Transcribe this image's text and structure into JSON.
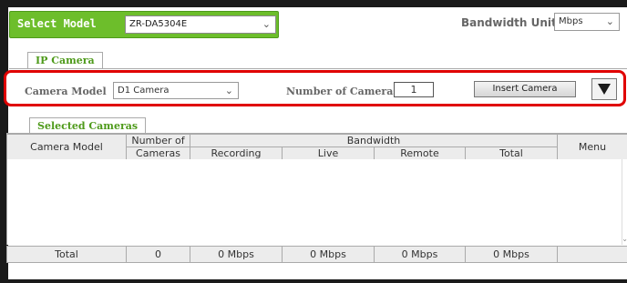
{
  "header": {
    "select_model_label": "Select Model",
    "model_value": "ZR-DA5304E",
    "bandwidth_unit_label": "Bandwidth Unit :",
    "bandwidth_unit_value": "Mbps"
  },
  "ip_camera": {
    "tab_label": "IP Camera",
    "camera_model_label": "Camera Model",
    "camera_model_value": "D1 Camera",
    "number_label": "Number of Cameras",
    "number_value": "1",
    "insert_label": "Insert Camera"
  },
  "selected": {
    "tab_label": "Selected Cameras",
    "columns": {
      "camera_model": "Camera Model",
      "number_of": "Number of",
      "cameras": "Cameras",
      "bandwidth": "Bandwidth",
      "recording": "Recording",
      "live": "Live",
      "remote": "Remote",
      "total": "Total",
      "menu": "Menu"
    },
    "totals": {
      "label": "Total",
      "count": "0",
      "recording": "0 Mbps",
      "live": "0 Mbps",
      "remote": "0 Mbps",
      "total": "0 Mbps"
    }
  },
  "icons": {
    "dropdown": "chevron-down-icon",
    "expand": "triangle-down-icon"
  },
  "colors": {
    "accent_green": "#6dbe2b",
    "highlight_red": "#e00000",
    "label_gray": "#666666"
  }
}
